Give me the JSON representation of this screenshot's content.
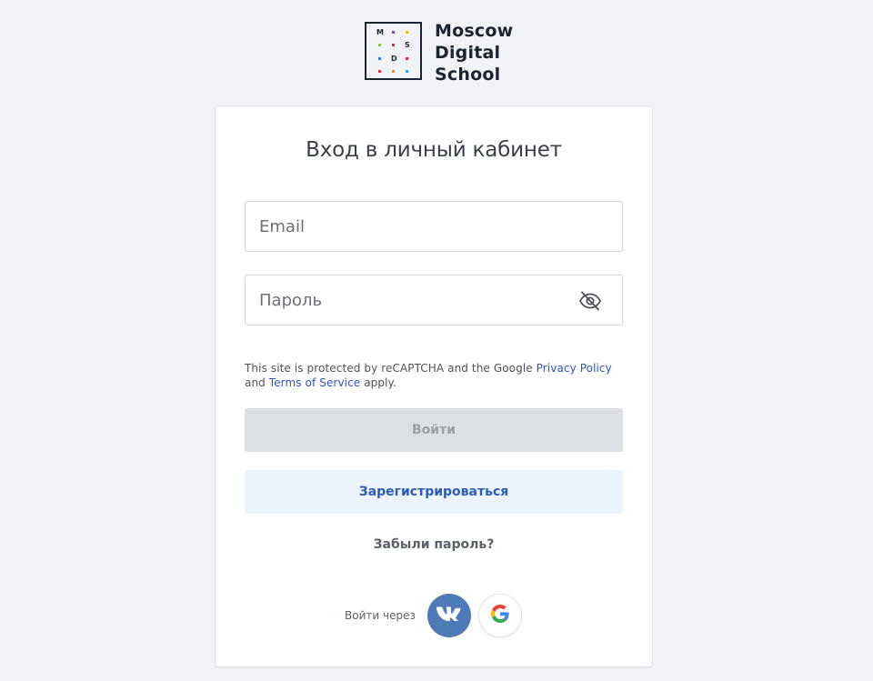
{
  "logo": {
    "box_letters": [
      "M",
      "S",
      "D"
    ],
    "text_lines": [
      "Moscow",
      "Digital",
      "School"
    ]
  },
  "login": {
    "title": "Вход в личный кабинет",
    "email_placeholder": "Email",
    "password_placeholder": "Пароль",
    "password_toggle_icon": "eye-off-icon",
    "recaptcha": {
      "prefix": "This site is protected by reCAPTCHA and the Google ",
      "privacy_link": "Privacy Policy",
      "middle": " and ",
      "terms_link": "Terms of Service",
      "suffix": " apply."
    },
    "login_button": "Войти",
    "register_button": "Зарегистрироваться",
    "forgot_password": "Забыли пароль?",
    "social_label": "Войти через",
    "social": [
      {
        "name": "VK",
        "icon": "vk-icon"
      },
      {
        "name": "Google",
        "icon": "google-icon"
      }
    ]
  },
  "colors": {
    "background": "#f1f3f7",
    "link": "#2c57b8",
    "register_bg": "#ebf4fd",
    "login_disabled_bg": "#dcdfe3",
    "vk": "#4e7ab8"
  }
}
